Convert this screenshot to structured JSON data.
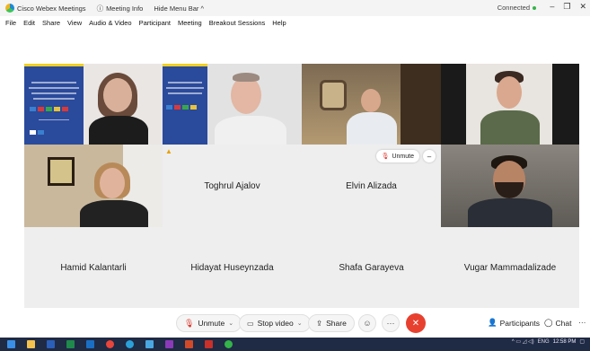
{
  "titlebar": {
    "app_name": "Cisco Webex Meetings",
    "meeting_info": "Meeting Info",
    "hide_menu": "Hide Menu Bar ^",
    "status": "Connected",
    "status_color": "#34b34a",
    "window_controls": [
      "–",
      "❐",
      "✕"
    ]
  },
  "menu": [
    "File",
    "Edit",
    "Share",
    "View",
    "Audio & Video",
    "Participant",
    "Meeting",
    "Breakout Sessions",
    "Help"
  ],
  "participants": {
    "video_row_top": [
      "",
      "",
      "",
      ""
    ],
    "toghrul": "Toghrul Ajalov",
    "elvin": "Elvin Alizada",
    "hamid": "Hamid Kalantarli",
    "hidayat": "Hidayat Huseynzada",
    "shafa": "Shafa Garayeva",
    "vugar": "Vugar Mammadalizade"
  },
  "tile_overlay": {
    "unmute": "Unmute",
    "more": "–"
  },
  "controls": {
    "unmute": "Unmute",
    "stop_video": "Stop video",
    "share": "Share",
    "reactions": "☺",
    "more": "···",
    "leave": "✕",
    "participants": "Participants",
    "chat": "Chat",
    "overflow": "···"
  },
  "taskbar": {
    "time": "12:58 PM",
    "lang": "ENG"
  },
  "colors": {
    "leave": "#e8402f",
    "mute": "#d93025",
    "slide_blue": "#2a4a9c",
    "taskbar": "#1f2a44"
  }
}
